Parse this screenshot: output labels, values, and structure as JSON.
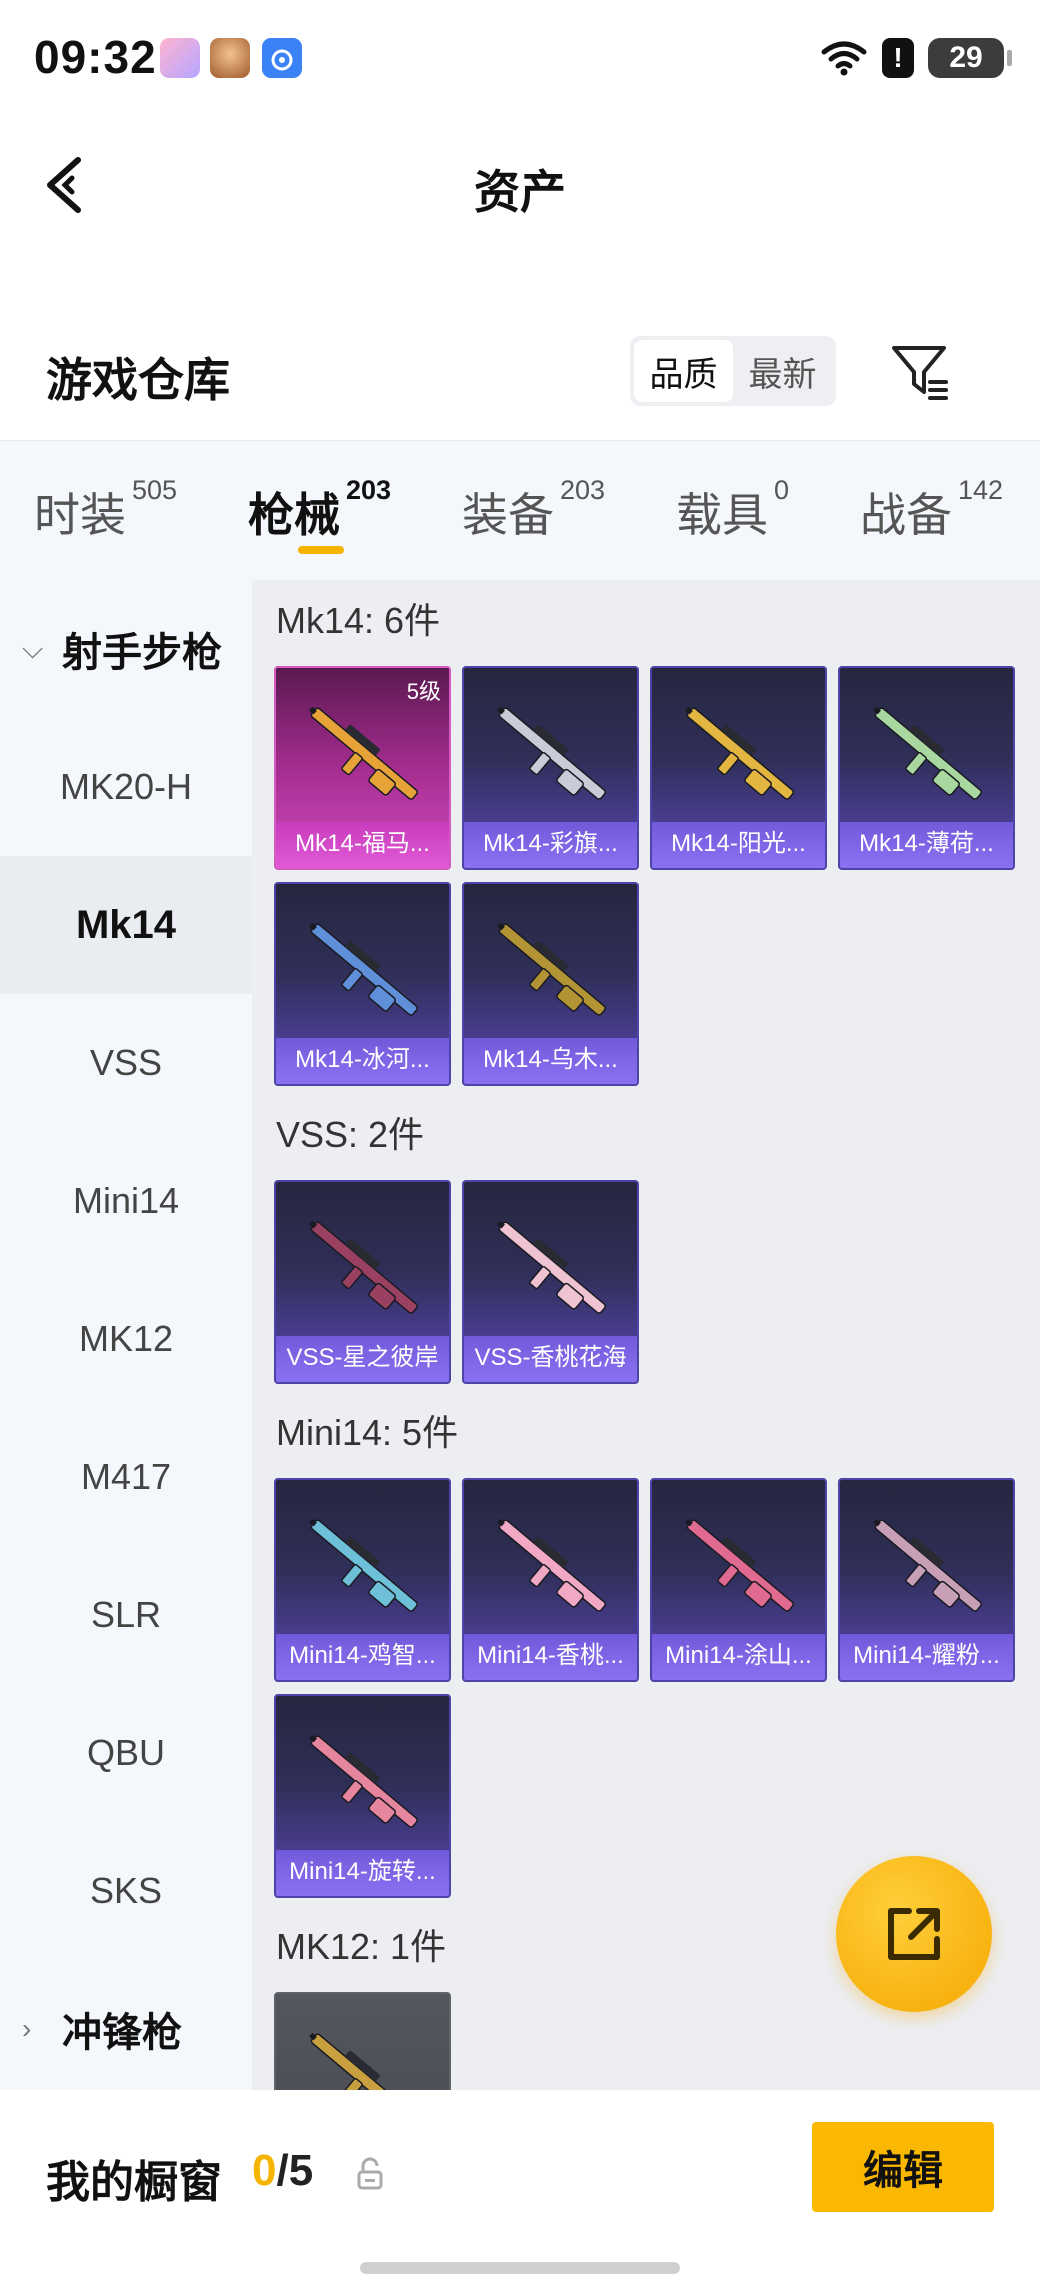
{
  "status_bar": {
    "time": "09:32",
    "battery": "29",
    "alert": "!"
  },
  "nav": {
    "title": "资产"
  },
  "warehouse": {
    "title": "游戏仓库",
    "sort_options": [
      "品质",
      "最新"
    ]
  },
  "tabs": [
    {
      "label": "时装",
      "count": "505"
    },
    {
      "label": "枪械",
      "count": "203"
    },
    {
      "label": "装备",
      "count": "203"
    },
    {
      "label": "载具",
      "count": "0"
    },
    {
      "label": "战备",
      "count": "142"
    }
  ],
  "sidebar": {
    "group": "射手步枪",
    "items": [
      "MK20-H",
      "Mk14",
      "VSS",
      "Mini14",
      "MK12",
      "M417",
      "SLR",
      "QBU",
      "SKS"
    ],
    "next_group": "冲锋枪"
  },
  "sections": [
    {
      "title": "Mk14: 6件",
      "items": [
        {
          "name": "Mk14-福马...",
          "level": "5级",
          "rarity": "pink",
          "color": "#e8a338"
        },
        {
          "name": "Mk14-彩旗...",
          "color": "#c9cbd6"
        },
        {
          "name": "Mk14-阳光...",
          "color": "#e2b640"
        },
        {
          "name": "Mk14-薄荷...",
          "color": "#a8d8a0"
        },
        {
          "name": "Mk14-冰河...",
          "color": "#5f8fd8"
        },
        {
          "name": "Mk14-乌木...",
          "color": "#b39435"
        }
      ]
    },
    {
      "title": "VSS: 2件",
      "items": [
        {
          "name": "VSS-星之彼岸",
          "color": "#9a4060"
        },
        {
          "name": "VSS-香桃花海",
          "color": "#f0c3d3"
        }
      ]
    },
    {
      "title": "Mini14: 5件",
      "items": [
        {
          "name": "Mini14-鸡智...",
          "color": "#6dc0d8"
        },
        {
          "name": "Mini14-香桃...",
          "color": "#f0a8c4"
        },
        {
          "name": "Mini14-涂山...",
          "color": "#e06a90"
        },
        {
          "name": "Mini14-耀粉...",
          "color": "#c7a0b8"
        },
        {
          "name": "Mini14-旋转...",
          "color": "#e5869e"
        }
      ]
    },
    {
      "title": "MK12: 1件",
      "items": [
        {
          "name": "",
          "rarity": "grey",
          "color": "#c8a040"
        }
      ]
    }
  ],
  "showcase": {
    "label": "我的橱窗",
    "used": "0",
    "total": "/5",
    "edit_label": "编辑"
  }
}
